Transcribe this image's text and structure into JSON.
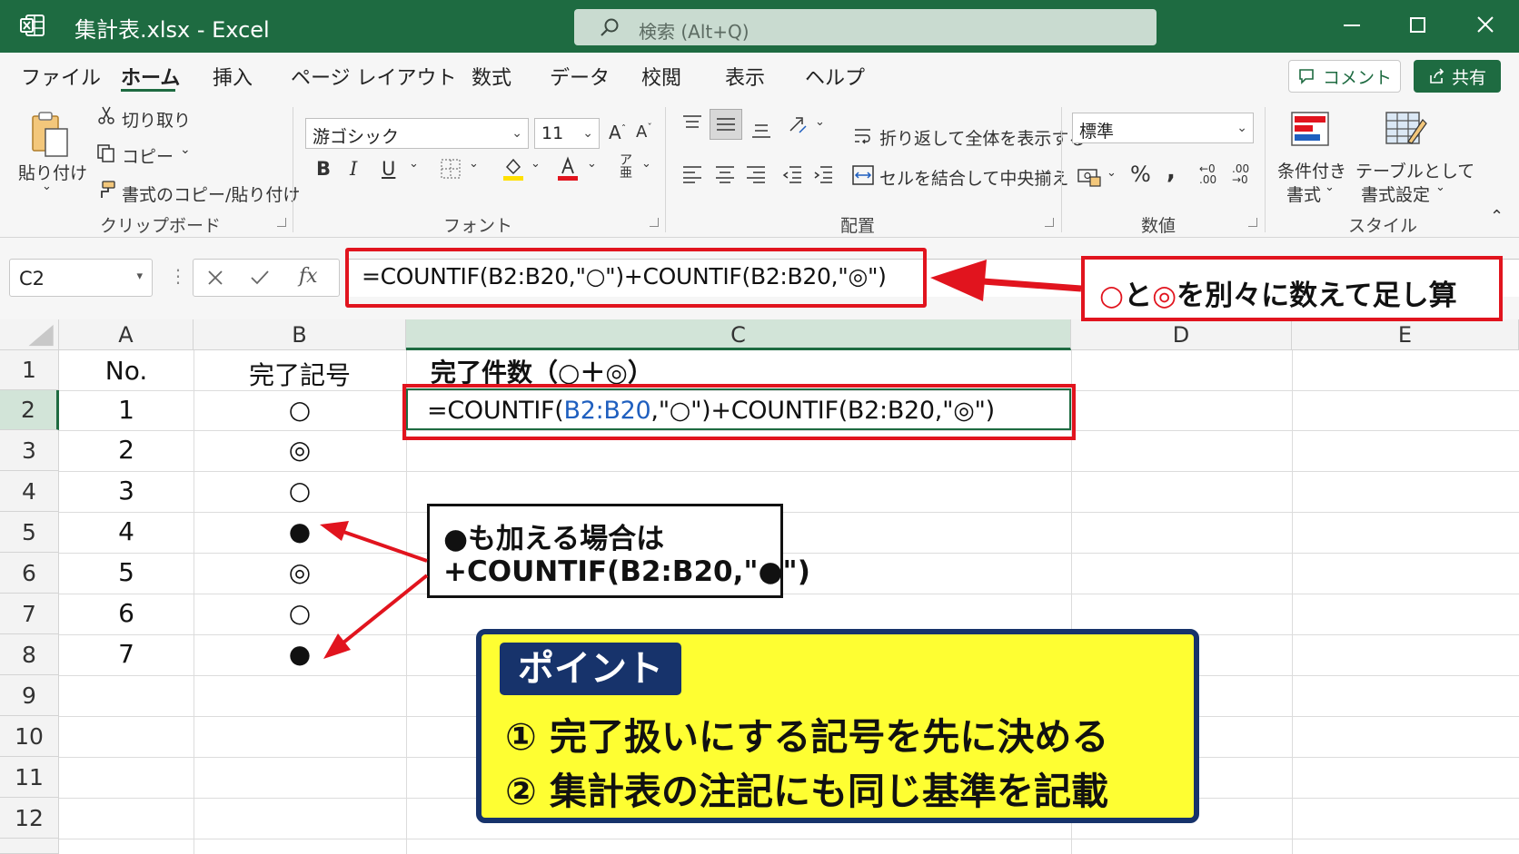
{
  "titlebar": {
    "document_title": "集計表.xlsx  -  Excel",
    "search_placeholder": "検索 (Alt+Q)",
    "accent_color": "#1e6b41"
  },
  "menu": {
    "items": [
      "ファイル",
      "ホーム",
      "挿入",
      "ページ レイアウト",
      "数式",
      "データ",
      "校閲",
      "表示",
      "ヘルプ"
    ],
    "active": "ホーム",
    "comment_label": "コメント",
    "share_label": "共有"
  },
  "ribbon": {
    "clipboard": {
      "paste_label": "貼り付け",
      "cut_label": "切り取り",
      "copy_label": "コピー",
      "format_painter_label": "書式のコピー/貼り付け",
      "group_label": "クリップボード"
    },
    "font": {
      "font_name": "游ゴシック",
      "font_size": "11",
      "bold": "B",
      "italic": "I",
      "underline": "U",
      "group_label": "フォント"
    },
    "alignment": {
      "wrap_text_label": "折り返して全体を表示する",
      "merge_center_label": "セルを結合して中央揃え",
      "group_label": "配置"
    },
    "number": {
      "format_value": "標準",
      "percent": "%",
      "comma": ",",
      "group_label": "数値"
    },
    "styles": {
      "conditional_label_line1": "条件付き",
      "conditional_label_line2": "書式",
      "table_label_line1": "テーブルとして",
      "table_label_line2": "書式設定",
      "group_label": "スタイル"
    }
  },
  "formula_bar": {
    "name_box": "C2",
    "fx": "fx",
    "formula": "=COUNTIF(B2:B20,\"○\")+COUNTIF(B2:B20,\"◎\")"
  },
  "sheet": {
    "columns": [
      "A",
      "B",
      "C",
      "D",
      "E"
    ],
    "selected_column": "C",
    "rows": [
      "1",
      "2",
      "3",
      "4",
      "5",
      "6",
      "7",
      "8",
      "9",
      "10",
      "11",
      "12"
    ],
    "selected_row": "2",
    "header_a": "No.",
    "header_b": "完了記号",
    "header_c": "完了件数（○＋◎）",
    "numbers": [
      "1",
      "2",
      "3",
      "4",
      "5",
      "6",
      "7"
    ],
    "symbols": [
      "○",
      "◎",
      "○",
      "●",
      "◎",
      "○",
      "●"
    ],
    "c2_prefix": "=COUNTIF(",
    "c2_ref": "B2:B20",
    "c2_suffix": ",\"○\")+COUNTIF(B2:B20,\"◎\")"
  },
  "annotations": {
    "top_callout": {
      "part1": "○",
      "part2": "と",
      "part3": "◎",
      "part4": "を別々に数えて足し算"
    },
    "mid_callout": {
      "line1": "●も加える場合は",
      "line2": "+COUNTIF(B2:B20,\"●\")"
    },
    "point": {
      "badge": "ポイント",
      "item1": "① 完了扱いにする記号を先に決める",
      "item2": "② 集計表の注記にも同じ基準を記載"
    },
    "highlight_color": "#e1141e",
    "point_fill_color": "#fefe32",
    "point_border_color": "#17336b"
  }
}
